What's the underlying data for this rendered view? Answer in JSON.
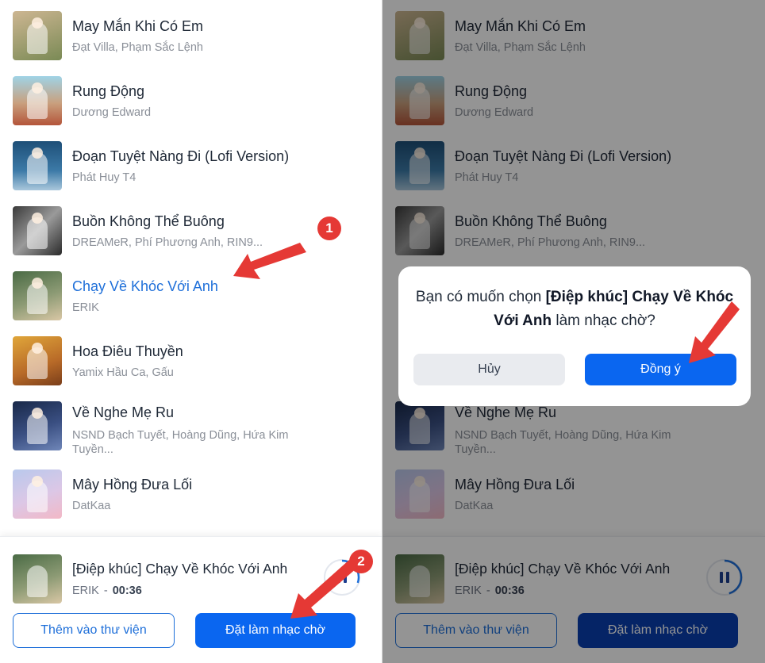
{
  "songs": [
    {
      "title": "May Mắn Khi Có Em",
      "artist": "Đạt Villa, Phạm Sắc Lệnh",
      "cover": [
        "#cdb692",
        "#7a8a55"
      ]
    },
    {
      "title": "Rung Động",
      "artist": "Dương Edward",
      "cover": [
        "#9fd3e6",
        "#b4553a"
      ]
    },
    {
      "title": "Đoạn Tuyệt Nàng Đi (Lofi Version)",
      "artist": "Phát Huy T4",
      "cover": [
        "#1e4f78",
        "#a9c7dc"
      ]
    },
    {
      "title": "Buồn Không Thể Buông",
      "artist": "DREAMeR, Phí Phương Anh, RIN9...",
      "cover": [
        "#3a3a3a",
        "#9a9a9a"
      ]
    },
    {
      "title": "Chạy Về Khóc Với Anh",
      "artist": "ERIK",
      "cover": [
        "#4a6b45",
        "#d9c7a5"
      ]
    },
    {
      "title": "Hoa Điêu Thuyền",
      "artist": "Yamix Hầu Ca, Gấu",
      "cover": [
        "#e0a63a",
        "#7a3e1a"
      ]
    },
    {
      "title": "Về Nghe Mẹ Ru",
      "artist": "NSND Bạch Tuyết, Hoàng Dũng, Hứa Kim Tuyền...",
      "cover": [
        "#182848",
        "#6f86b8"
      ]
    },
    {
      "title": "Mây Hồng Đưa Lối",
      "artist": "DatKaa",
      "cover": [
        "#b9c9ec",
        "#f2b8c6"
      ]
    }
  ],
  "player": {
    "title": "[Điệp khúc] Chạy Về Khóc Với Anh",
    "artist": "ERIK",
    "separator": "-",
    "time": "00:36",
    "add_label": "Thêm vào thư viện",
    "set_label": "Đặt làm nhạc chờ"
  },
  "markers": {
    "step1": "1",
    "step2": "2"
  },
  "dialog": {
    "msg_prefix": "Bạn có muốn chọn ",
    "msg_bold": "[Điệp khúc] Chạy Về Khóc Với Anh",
    "msg_suffix": " làm nhạc chờ?",
    "cancel_label": "Hủy",
    "confirm_label": "Đồng ý"
  },
  "colors": {
    "accent": "#0a66f0",
    "active_title": "#1e6fd9",
    "marker": "#e53935"
  },
  "icons": {
    "play_state": "pause-icon",
    "arrow": "red-arrow-icon"
  }
}
